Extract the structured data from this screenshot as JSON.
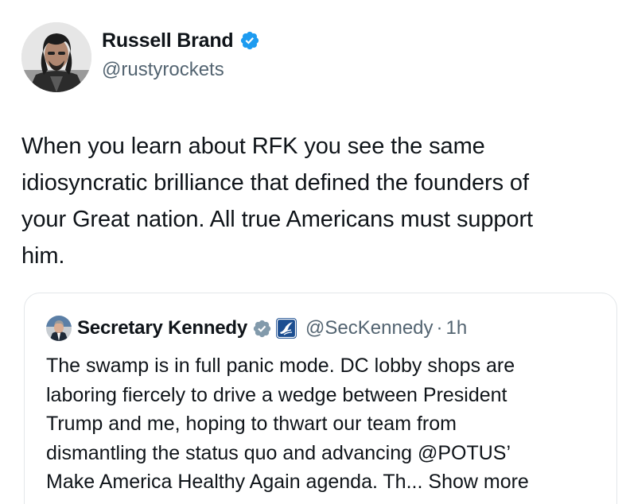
{
  "author": {
    "display_name": "Russell Brand",
    "handle": "@rustyrockets",
    "verified": true,
    "avatar_icon": "profile-photo",
    "verified_icon": "verified-badge-icon"
  },
  "tweet": {
    "text": "When you learn about RFK you see the same\nidiosyncratic brilliance that defined the founders of\nyour Great nation. All true Americans must support\nhim."
  },
  "quoted_tweet": {
    "display_name": "Secretary Kennedy",
    "handle": "@SecKennedy",
    "separator": "·",
    "time": "1h",
    "verified_icon": "verified-badge-grey-icon",
    "affiliation_icon": "hhs-seal-icon",
    "text": "The swamp is in full panic mode. DC lobby shops are\nlaboring fiercely to drive a wedge between President\nTrump and me, hoping to thwart our team from\ndismantling the status quo and advancing @POTUS’\nMake America Healthy Again agenda. Th...",
    "show_more": "Show more"
  },
  "colors": {
    "text_primary": "#0f1419",
    "text_secondary": "#536471",
    "verified_blue": "#1d9bf0",
    "verified_grey": "#829aab",
    "border": "#e4e7ea",
    "affiliation_bg": "#1d4f91"
  }
}
